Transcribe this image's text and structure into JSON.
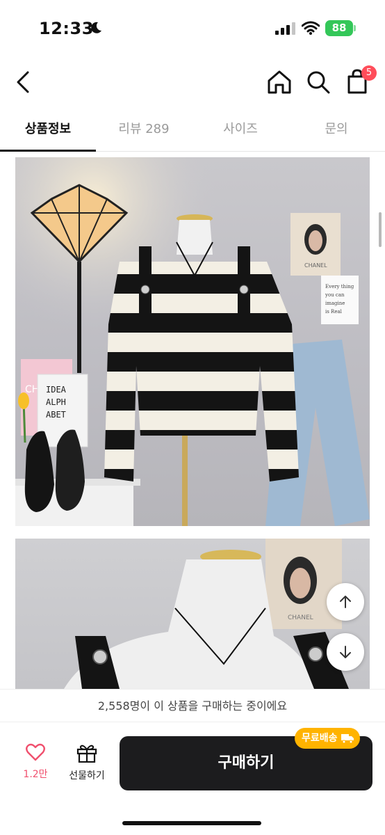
{
  "status_bar": {
    "time": "12:33",
    "battery": "88"
  },
  "nav": {
    "cart_count": "5"
  },
  "tabs": [
    {
      "label": "상품정보",
      "active": true
    },
    {
      "label": "리뷰 289",
      "active": false
    },
    {
      "label": "사이즈",
      "active": false
    },
    {
      "label": "문의",
      "active": false
    }
  ],
  "images": {
    "image1_props": {
      "idea_card": [
        "IDEA",
        "ALPH",
        "ABET"
      ],
      "brand_card_1": "CH",
      "brand_card_2": "CHANEL",
      "note_lines": [
        "Every thing",
        "you can",
        "imagine",
        "is Real"
      ]
    },
    "image2_props": {
      "brand_card": "CHANEL"
    }
  },
  "bottom": {
    "buyers_text": "2,558명이 이 상품을 구매하는 중이에요",
    "like_count": "1.2만",
    "gift_label": "선물하기",
    "buy_label": "구매하기",
    "shipping_label": "무료배송"
  },
  "colors": {
    "accent_pink": "#f0506e",
    "badge_red": "#ff4d5a",
    "shipping_yellow": "#ffb300",
    "buy_dark": "#1c1c1e",
    "battery_green": "#34c759"
  },
  "icons": [
    "moon-icon",
    "signal-icon",
    "wifi-icon",
    "back-icon",
    "home-icon",
    "search-icon",
    "cart-icon",
    "arrow-up-icon",
    "arrow-down-icon",
    "heart-icon",
    "gift-icon",
    "truck-icon"
  ]
}
